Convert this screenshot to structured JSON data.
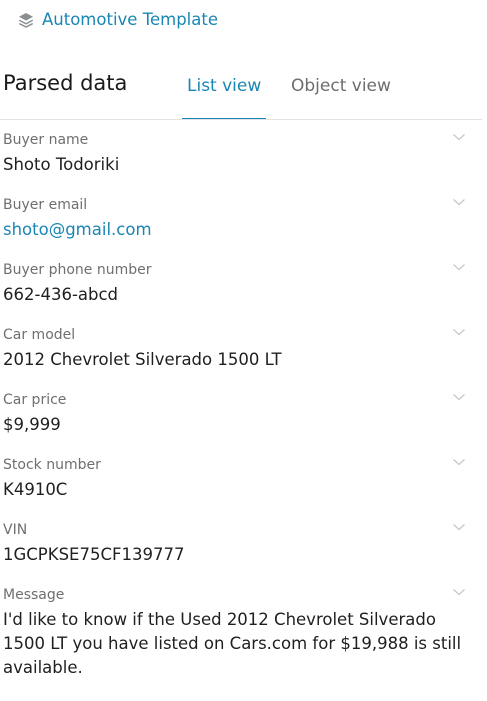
{
  "template": {
    "icon": "layers-icon",
    "label": "Automotive Template"
  },
  "header": {
    "title": "Parsed data",
    "tabs": [
      {
        "label": "List view",
        "active": true
      },
      {
        "label": "Object view",
        "active": false
      }
    ]
  },
  "fields": [
    {
      "label": "Buyer name",
      "value": "Shoto Todoriki"
    },
    {
      "label": "Buyer email",
      "value": "shoto@gmail.com"
    },
    {
      "label": "Buyer phone number",
      "value": "662-436-abcd"
    },
    {
      "label": "Car model",
      "value": "2012 Chevrolet Silverado 1500 LT"
    },
    {
      "label": "Car price",
      "value": "$9,999"
    },
    {
      "label": "Stock number",
      "value": "K4910C"
    },
    {
      "label": "VIN",
      "value": "1GCPKSE75CF139777"
    },
    {
      "label": "Message",
      "value": "I'd like to know if the Used 2012 Chevrolet Silverado 1500 LT you have listed on Cars.com for $19,988 is still available."
    }
  ],
  "colors": {
    "accent": "#1a86b4",
    "label": "#6f6f6f",
    "text": "#1f1f1f",
    "chevron": "#c8c8c8"
  }
}
